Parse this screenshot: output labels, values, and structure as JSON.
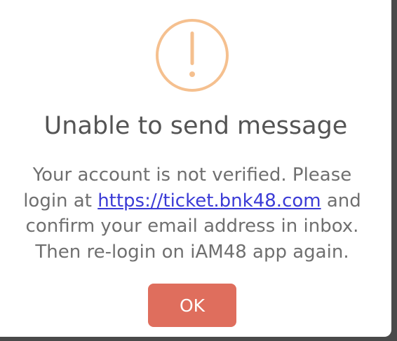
{
  "dialog": {
    "icon": "exclamation-circle-icon",
    "icon_color": "#f5c08f",
    "title": "Unable to send message",
    "message": {
      "line1": "Your account is not verified. Please",
      "line2_prefix": "login at ",
      "link": "https://ticket.bnk48.com",
      "line2_suffix": " and",
      "line3": "confirm your email address in inbox.",
      "line4": "Then re-login on iAM48 app again."
    },
    "ok_label": "OK",
    "ok_color": "#df6e5d",
    "link_color": "#3b3bd6"
  }
}
